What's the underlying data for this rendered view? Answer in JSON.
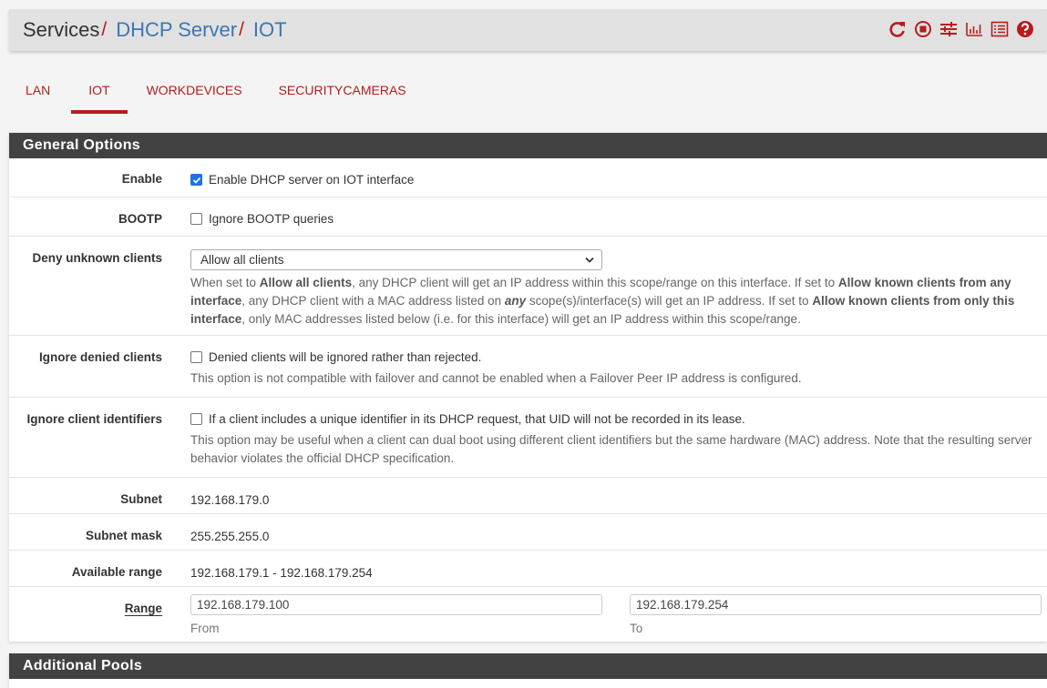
{
  "breadcrumb": {
    "items": [
      {
        "label": "Services",
        "link": false
      },
      {
        "label": "DHCP Server",
        "link": true
      },
      {
        "label": "IOT",
        "link": true
      }
    ],
    "separator": "/"
  },
  "header_icons": [
    {
      "name": "reload-icon",
      "title": "Restart service"
    },
    {
      "name": "stop-icon",
      "title": "Stop service"
    },
    {
      "name": "sliders-icon",
      "title": "Related settings"
    },
    {
      "name": "chart-icon",
      "title": "Related status"
    },
    {
      "name": "log-list-icon",
      "title": "Related log entries"
    },
    {
      "name": "help-icon",
      "title": "Help"
    }
  ],
  "tabs": [
    {
      "label": "LAN",
      "active": false
    },
    {
      "label": "IOT",
      "active": true
    },
    {
      "label": "WORKDEVICES",
      "active": false
    },
    {
      "label": "SECURITYCAMERAS",
      "active": false
    }
  ],
  "general": {
    "heading": "General Options",
    "enable": {
      "label": "Enable",
      "text": "Enable DHCP server on IOT interface",
      "checked": true
    },
    "bootp": {
      "label": "BOOTP",
      "text": "Ignore BOOTP queries",
      "checked": false
    },
    "deny": {
      "label": "Deny unknown clients",
      "selected": "Allow all clients",
      "help": {
        "p1": "When set to ",
        "b1": "Allow all clients",
        "p2": ", any DHCP client will get an IP address within this scope/range on this interface. If set to ",
        "b2": "Allow known clients from any interface",
        "p3": ", any DHCP client with a MAC address listed on ",
        "i1": "any",
        "p4": " scope(s)/interface(s) will get an IP address. If set to ",
        "b3": "Allow known clients from only this interface",
        "p5": ", only MAC addresses listed below (i.e. for this interface) will get an IP address within this scope/range."
      }
    },
    "ignore_denied": {
      "label": "Ignore denied clients",
      "text": "Denied clients will be ignored rather than rejected.",
      "checked": false,
      "help": "This option is not compatible with failover and cannot be enabled when a Failover Peer IP address is configured."
    },
    "ignore_uid": {
      "label": "Ignore client identifiers",
      "text": "If a client includes a unique identifier in its DHCP request, that UID will not be recorded in its lease.",
      "checked": false,
      "help": "This option may be useful when a client can dual boot using different client identifiers but the same hardware (MAC) address. Note that the resulting server behavior violates the official DHCP specification."
    },
    "subnet": {
      "label": "Subnet",
      "value": "192.168.179.0"
    },
    "subnet_mask": {
      "label": "Subnet mask",
      "value": "255.255.255.0"
    },
    "available_range": {
      "label": "Available range",
      "value": "192.168.179.1 - 192.168.179.254"
    },
    "range": {
      "label": "Range",
      "from": {
        "value": "192.168.179.100",
        "sublabel": "From"
      },
      "to": {
        "value": "192.168.179.254",
        "sublabel": "To"
      }
    }
  },
  "pools": {
    "heading": "Additional Pools"
  },
  "colors": {
    "accent": "#b71c1c",
    "link": "#3b77b5",
    "panel_heading": "#424242"
  }
}
